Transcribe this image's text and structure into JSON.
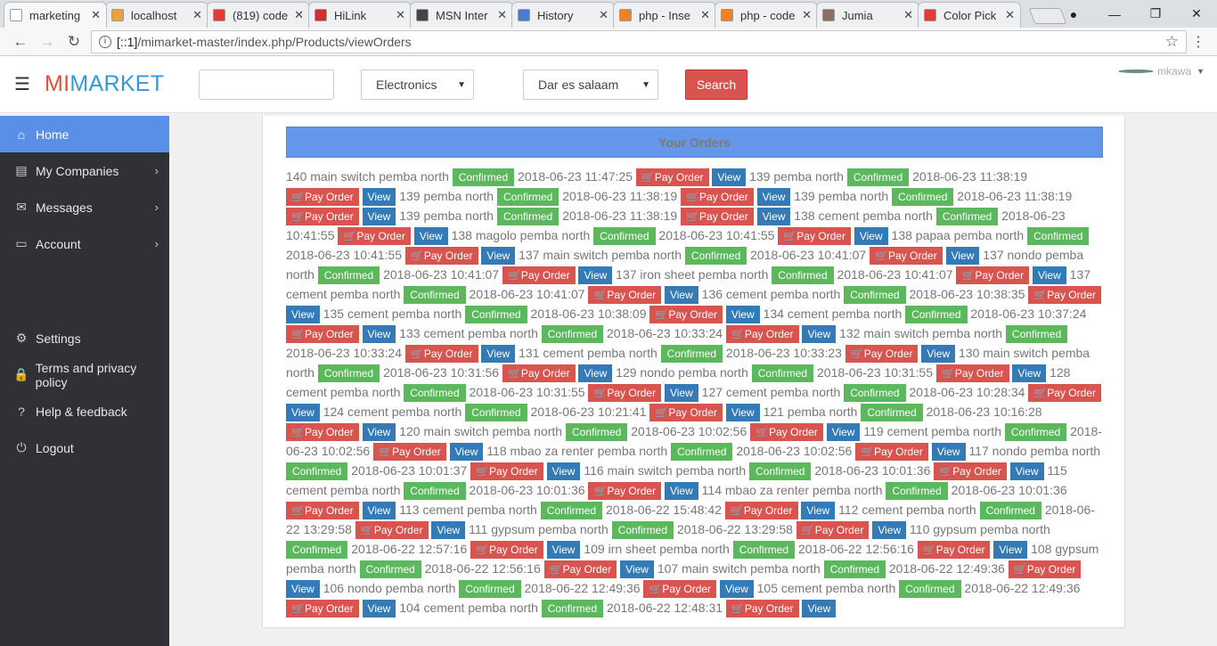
{
  "browser": {
    "tabs": [
      {
        "title": "marketing",
        "color": "#ffffff",
        "active": true
      },
      {
        "title": "localhost",
        "color": "#e8a33d"
      },
      {
        "title": "(819) code",
        "color": "#e53935"
      },
      {
        "title": "HiLink",
        "color": "#d32f2f"
      },
      {
        "title": "MSN Inter",
        "color": "#444444"
      },
      {
        "title": "History",
        "color": "#4a7bd0"
      },
      {
        "title": "php - Inse",
        "color": "#f48024"
      },
      {
        "title": "php - code",
        "color": "#f48024"
      },
      {
        "title": "Jumia",
        "color": "#8d6e63"
      },
      {
        "title": "Color Pick",
        "color": "#e53935"
      }
    ],
    "url_prefix": "[::1]",
    "url_path": "/mimarket-master/index.php/Products/viewOrders"
  },
  "header": {
    "logo_a": "MI",
    "logo_b": "MARKET",
    "category_value": "Electronics",
    "location_value": "Dar es salaam",
    "search_label": "Search",
    "username": "mkawa"
  },
  "sidebar": {
    "items": [
      {
        "label": "Home",
        "icon": "home-icon",
        "glyph": "⌂"
      },
      {
        "label": "My Companies",
        "icon": "list-icon",
        "glyph": "▤"
      },
      {
        "label": "Messages",
        "icon": "envelope-icon",
        "glyph": "✉"
      },
      {
        "label": "Account",
        "icon": "card-icon",
        "glyph": "▭"
      },
      {
        "label": "Settings",
        "icon": "gear-icon",
        "glyph": "⚙"
      },
      {
        "label": "Terms and privacy policy",
        "icon": "lock-icon",
        "glyph": "🔒"
      },
      {
        "label": "Help & feedback",
        "icon": "question-icon",
        "glyph": "?"
      },
      {
        "label": "Logout",
        "icon": "power-icon",
        "glyph": "⏻"
      }
    ]
  },
  "main": {
    "title": "Your Orders",
    "status_label": "Confirmed",
    "pay_label": "Pay Order",
    "view_label": "View",
    "orders": [
      {
        "id": "140",
        "name": "main switch pemba north",
        "date": "2018-06-23 11:47:25"
      },
      {
        "id": "139",
        "name": "pemba north",
        "date": "2018-06-23 11:38:19"
      },
      {
        "id": "139",
        "name": "pemba north",
        "date": "2018-06-23 11:38:19"
      },
      {
        "id": "139",
        "name": "pemba north",
        "date": "2018-06-23 11:38:19"
      },
      {
        "id": "139",
        "name": "pemba north",
        "date": "2018-06-23 11:38:19"
      },
      {
        "id": "138",
        "name": "cement pemba north",
        "date": "2018-06-23 10:41:55"
      },
      {
        "id": "138",
        "name": "magolo pemba north",
        "date": "2018-06-23 10:41:55"
      },
      {
        "id": "138",
        "name": "papaa pemba north",
        "date": "2018-06-23 10:41:55"
      },
      {
        "id": "137",
        "name": "main switch pemba north",
        "date": "2018-06-23 10:41:07"
      },
      {
        "id": "137",
        "name": "nondo pemba north",
        "date": "2018-06-23 10:41:07"
      },
      {
        "id": "137",
        "name": "iron sheet pemba north",
        "date": "2018-06-23 10:41:07"
      },
      {
        "id": "137",
        "name": "cement pemba north",
        "date": "2018-06-23 10:41:07"
      },
      {
        "id": "136",
        "name": "cement pemba north",
        "date": "2018-06-23 10:38:35"
      },
      {
        "id": "135",
        "name": "cement pemba north",
        "date": "2018-06-23 10:38:09"
      },
      {
        "id": "134",
        "name": "cement pemba north",
        "date": "2018-06-23 10:37:24"
      },
      {
        "id": "133",
        "name": "cement pemba north",
        "date": "2018-06-23 10:33:24"
      },
      {
        "id": "132",
        "name": "main switch pemba north",
        "date": "2018-06-23 10:33:24"
      },
      {
        "id": "131",
        "name": "cement pemba north",
        "date": "2018-06-23 10:33:23"
      },
      {
        "id": "130",
        "name": "main switch pemba north",
        "date": "2018-06-23 10:31:56"
      },
      {
        "id": "129",
        "name": "nondo pemba north",
        "date": "2018-06-23 10:31:55"
      },
      {
        "id": "128",
        "name": "cement pemba north",
        "date": "2018-06-23 10:31:55"
      },
      {
        "id": "127",
        "name": "cement pemba north",
        "date": "2018-06-23 10:28:34"
      },
      {
        "id": "124",
        "name": "cement pemba north",
        "date": "2018-06-23 10:21:41"
      },
      {
        "id": "121",
        "name": "pemba north",
        "date": "2018-06-23 10:16:28"
      },
      {
        "id": "120",
        "name": "main switch pemba north",
        "date": "2018-06-23 10:02:56"
      },
      {
        "id": "119",
        "name": "cement pemba north",
        "date": "2018-06-23 10:02:56"
      },
      {
        "id": "118",
        "name": "mbao za renter pemba north",
        "date": "2018-06-23 10:02:56"
      },
      {
        "id": "117",
        "name": "nondo pemba north",
        "date": "2018-06-23 10:01:37"
      },
      {
        "id": "116",
        "name": "main switch pemba north",
        "date": "2018-06-23 10:01:36"
      },
      {
        "id": "115",
        "name": "cement pemba north",
        "date": "2018-06-23 10:01:36"
      },
      {
        "id": "114",
        "name": "mbao za renter pemba north",
        "date": "2018-06-23 10:01:36"
      },
      {
        "id": "113",
        "name": "cement pemba north",
        "date": "2018-06-22 15:48:42"
      },
      {
        "id": "112",
        "name": "cement pemba north",
        "date": "2018-06-22 13:29:58"
      },
      {
        "id": "111",
        "name": "gypsum pemba north",
        "date": "2018-06-22 13:29:58"
      },
      {
        "id": "110",
        "name": "gypsum pemba north",
        "date": "2018-06-22 12:57:16"
      },
      {
        "id": "109",
        "name": "irn sheet pemba north",
        "date": "2018-06-22 12:56:16"
      },
      {
        "id": "108",
        "name": "gypsum pemba north",
        "date": "2018-06-22 12:56:16"
      },
      {
        "id": "107",
        "name": "main switch pemba north",
        "date": "2018-06-22 12:49:36"
      },
      {
        "id": "106",
        "name": "nondo pemba north",
        "date": "2018-06-22 12:49:36"
      },
      {
        "id": "105",
        "name": "cement pemba north",
        "date": "2018-06-22 12:49:36"
      },
      {
        "id": "104",
        "name": "cement pemba north",
        "date": "2018-06-22 12:48:31"
      }
    ]
  }
}
